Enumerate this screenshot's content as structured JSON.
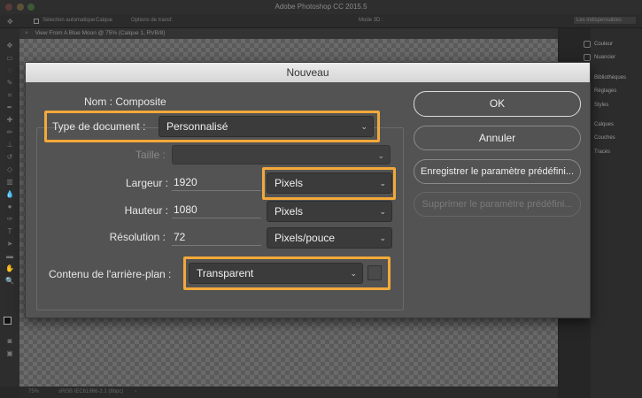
{
  "app": {
    "title": "Adobe Photoshop CC 2015.5",
    "workspace": "Les indispensables"
  },
  "options": {
    "auto_select_label": "Sélection automatique :",
    "auto_select_value": "Calque",
    "transform_label": "Options de transf.",
    "mode3d": "Mode 3D :"
  },
  "document": {
    "tab": "View From A Blue Moon @ 75% (Calque 1, RVB/8)",
    "zoom": "75%",
    "profile": "sRGB IEC61966-2.1 (8bpc)"
  },
  "panels": [
    "Couleur",
    "Nuancier",
    "Bibliothèques",
    "Réglages",
    "Styles",
    "Calques",
    "Couches",
    "Tracés"
  ],
  "dialog": {
    "title": "Nouveau",
    "name_label": "Nom : Composite",
    "doc_type_label": "Type de document :",
    "doc_type_value": "Personnalisé",
    "size_label": "Taille :",
    "size_value": "",
    "width_label": "Largeur :",
    "width_value": "1920",
    "width_unit": "Pixels",
    "height_label": "Hauteur :",
    "height_value": "1080",
    "height_unit": "Pixels",
    "resolution_label": "Résolution :",
    "resolution_value": "72",
    "resolution_unit": "Pixels/pouce",
    "background_label": "Contenu de l'arrière-plan :",
    "background_value": "Transparent",
    "ok": "OK",
    "cancel": "Annuler",
    "save_preset": "Enregistrer le paramètre prédéfini...",
    "delete_preset": "Supprimer le paramètre prédéfini...",
    "chevron": "⌄"
  },
  "colors": {
    "highlight": "#f3a93a"
  }
}
